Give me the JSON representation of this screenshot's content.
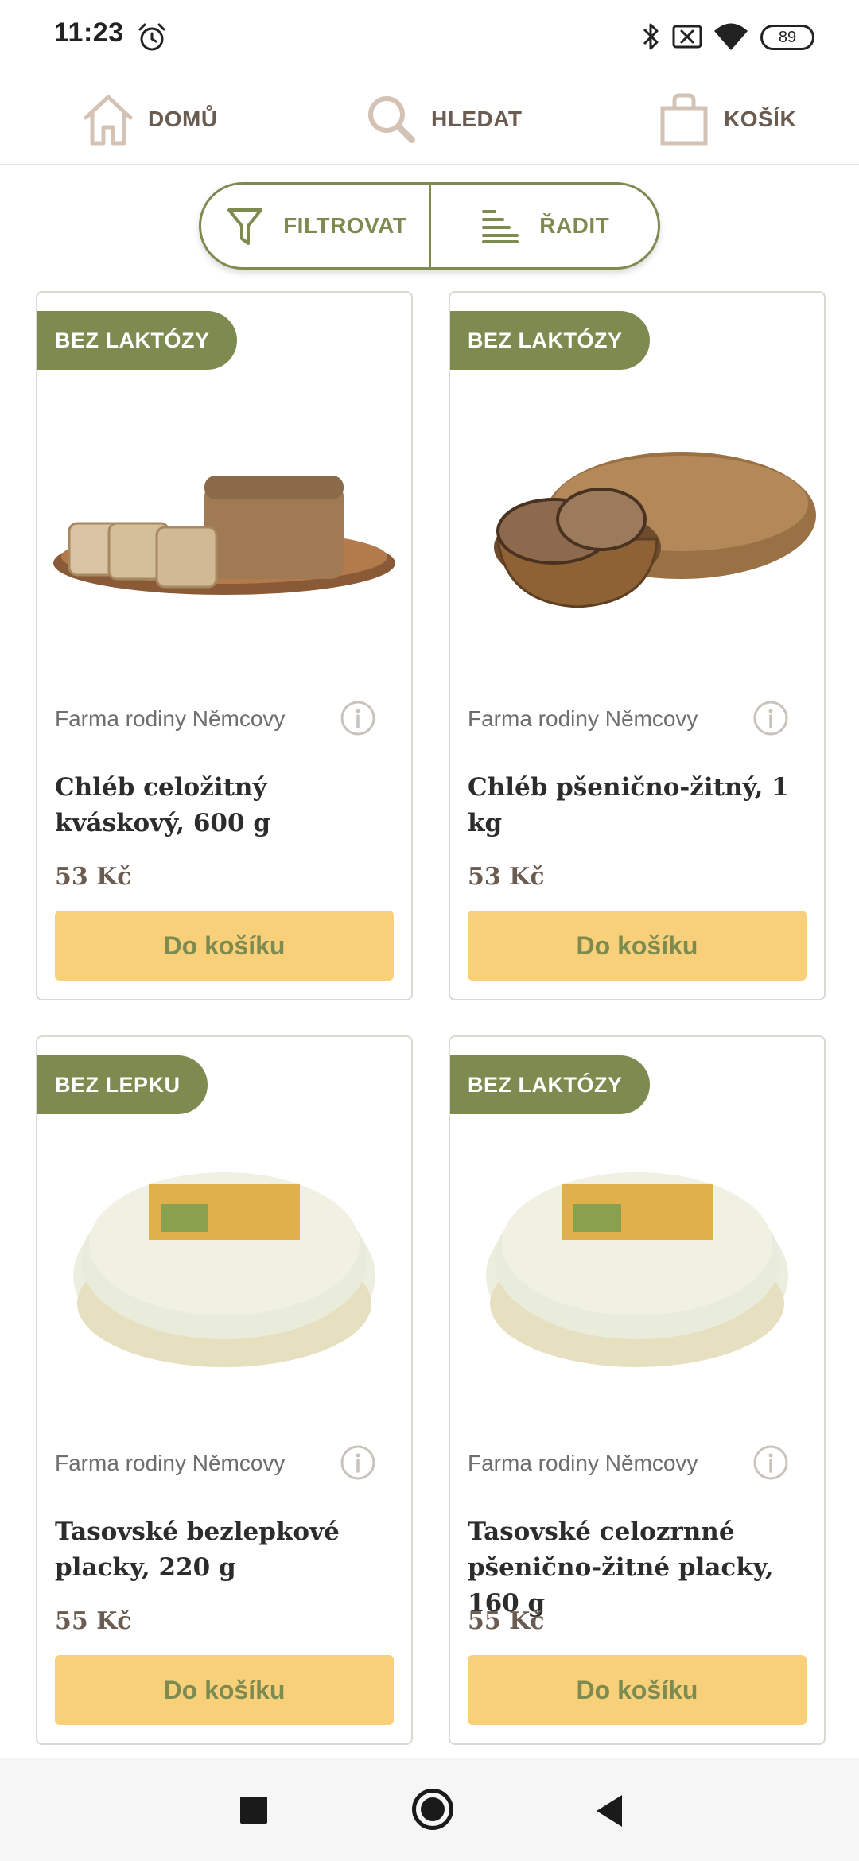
{
  "status_bar": {
    "time": "11:23",
    "battery": "89",
    "icons": [
      "alarm-icon",
      "bluetooth-icon",
      "no-sim-icon",
      "wifi-icon",
      "battery-icon"
    ]
  },
  "nav": {
    "home_label": "DOMŮ",
    "search_label": "HLEDAT",
    "cart_label": "KOŠÍK",
    "icons": [
      "home-icon",
      "search-icon",
      "shopping-bag-icon"
    ]
  },
  "controls": {
    "filter_label": "FILTROVAT",
    "sort_label": "ŘADIT",
    "icons": [
      "filter-icon",
      "sort-icon"
    ]
  },
  "colors": {
    "accent_green": "#7d8b50",
    "button_yellow": "#f8d07a",
    "brown_text": "#6b5c52"
  },
  "products": [
    {
      "badge": "BEZ LAKTÓZY",
      "producer": "Farma rodiny Němcovy",
      "title": "Chléb celožitný kváskový, 600 g",
      "price": "53 Kč",
      "button": "Do košíku",
      "image": "sliced-bread-on-tray"
    },
    {
      "badge": "BEZ LAKTÓZY",
      "producer": "Farma rodiny Němcovy",
      "title": "Chléb pšenično-žitný, 1 kg",
      "price": "53 Kč",
      "button": "Do košíku",
      "image": "bread-loaf-with-basket"
    },
    {
      "badge": "BEZ LEPKU",
      "producer": "Farma rodiny Němcovy",
      "title": "Tasovské bezlepkové placky, 220 g",
      "price": "55 Kč",
      "button": "Do košíku",
      "image": "flatbread-stack"
    },
    {
      "badge": "BEZ LAKTÓZY",
      "producer": "Farma rodiny Němcovy",
      "title": "Tasovské celozrnné pšenično-žitné placky, 160 g",
      "price": "55 Kč",
      "button": "Do košíku",
      "image": "flatbread-stack"
    }
  ]
}
